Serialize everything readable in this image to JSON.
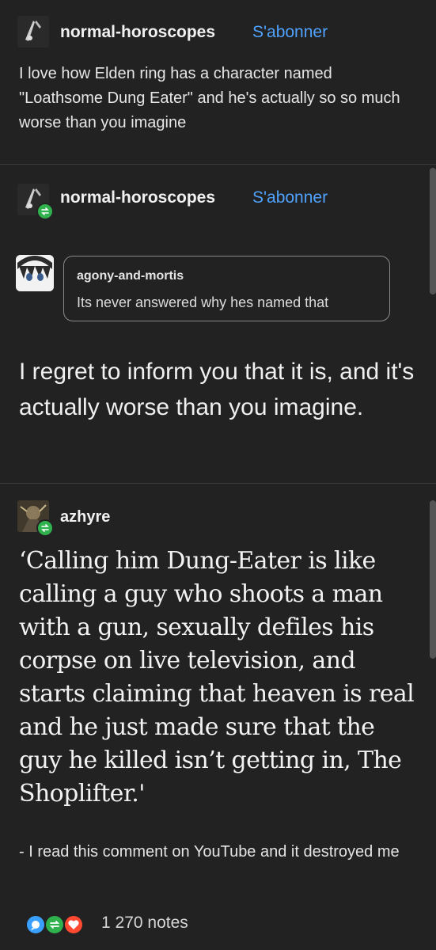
{
  "post1": {
    "username": "normal-horoscopes",
    "follow_label": "S'abonner",
    "text": "I love how Elden ring has a character named \"Loathsome Dung Eater\" and he's actually so so much worse than you imagine"
  },
  "post2": {
    "username": "normal-horoscopes",
    "follow_label": "S'abonner",
    "quoted_user": "agony-and-mortis",
    "quoted_text": "Its never answered why hes named that",
    "text": "I regret to inform you that it is, and it's actually worse than you imagine."
  },
  "post3": {
    "username": "azhyre",
    "quote": "‘Calling him Dung-Eater is like calling a guy who shoots a man with a gun, sexually defiles his corpse on live television, and starts claiming that heaven is real and he just made sure that the guy he killed isn’t getting in, The Shoplifter.'",
    "attribution": "- I read this comment on YouTube and it destroyed me"
  },
  "notes": {
    "count_label": "1 270 notes",
    "icons": [
      "reply-icon",
      "reblog-icon",
      "like-icon"
    ]
  },
  "colors": {
    "background": "#222222",
    "link": "#4fa3ff",
    "reblog_green": "#2fb14e",
    "reply_blue": "#3aa0ff",
    "like_red": "#ff4930"
  }
}
